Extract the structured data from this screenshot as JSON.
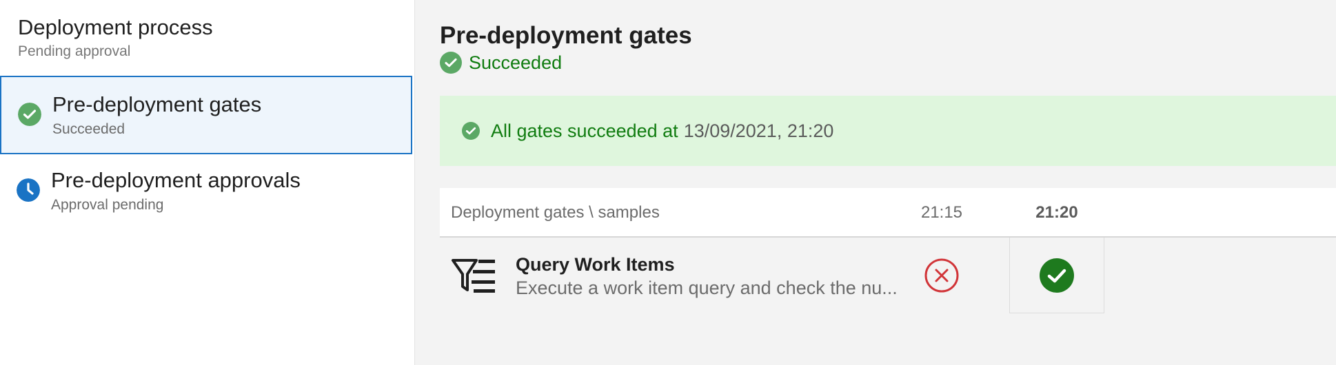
{
  "colors": {
    "success": "#107c10",
    "success_icon": "#5ba865",
    "pending": "#1a73c4",
    "error": "#d13438",
    "selection_border": "#1a73c4",
    "banner_bg": "#dff6dd"
  },
  "sidebar": {
    "section_title": "Deployment process",
    "section_subtitle": "Pending approval",
    "steps": [
      {
        "title": "Pre-deployment gates",
        "subtitle": "Succeeded",
        "icon": "check-circle-icon",
        "selected": true
      },
      {
        "title": "Pre-deployment approvals",
        "subtitle": "Approval pending",
        "icon": "clock-icon",
        "selected": false
      }
    ]
  },
  "main": {
    "title": "Pre-deployment gates",
    "status": "Succeeded",
    "banner": {
      "text": "All gates succeeded at",
      "time": "13/09/2021, 21:20",
      "icon": "check-circle-icon"
    },
    "table": {
      "name_header": "Deployment gates \\ samples",
      "time_columns": [
        "21:15",
        "21:20"
      ],
      "rows": [
        {
          "title": "Query Work Items",
          "description": "Execute a work item query and check the nu...",
          "icon": "filter-list-icon",
          "results": [
            "failed",
            "succeeded"
          ]
        }
      ]
    }
  }
}
